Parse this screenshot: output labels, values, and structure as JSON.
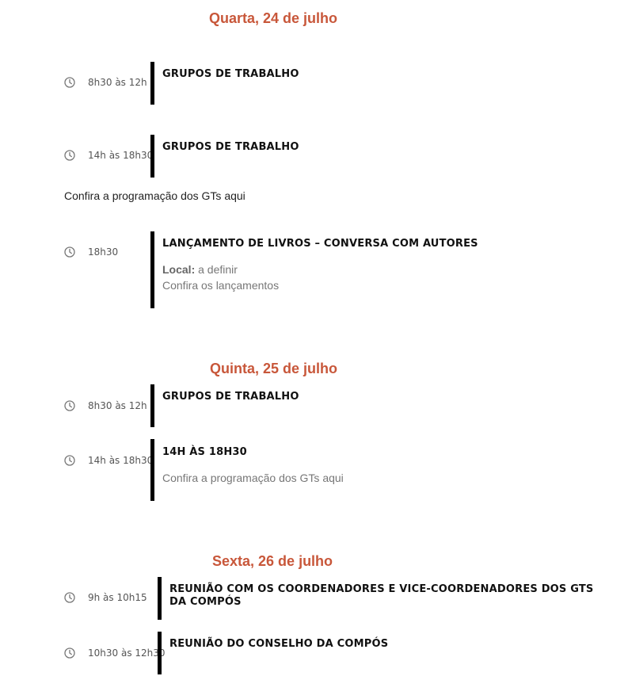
{
  "days": [
    {
      "title": "Quarta, 24 de julho",
      "events": [
        {
          "time": "8h30 às 12h",
          "title": "GRUPOS DE TRABALHO"
        },
        {
          "time": "14h às 18h30",
          "title": "GRUPOS DE TRABALHO"
        },
        {
          "time": "18h30",
          "title": "LANÇAMENTO DE LIVROS – CONVERSA COM AUTORES",
          "local_label": "Local:",
          "local_value": "a definir",
          "link": "Confira os lançamentos"
        }
      ],
      "note": "Confira a programação dos GTs aqui"
    },
    {
      "title": "Quinta, 25 de julho",
      "events": [
        {
          "time": "8h30 às 12h",
          "title": "GRUPOS DE TRABALHO"
        },
        {
          "time": "14h às 18h30",
          "title": "14H ÀS 18H30",
          "link": "Confira a programação dos GTs aqui"
        }
      ]
    },
    {
      "title": "Sexta, 26 de julho",
      "events": [
        {
          "time": "9h às 10h15",
          "title": "REUNIÃO COM OS COORDENADORES E VICE-COORDENADORES DOS GTS DA COMPÓS"
        },
        {
          "time": "10h30 às 12h30",
          "title": "REUNIÃO DO CONSELHO DA COMPÓS"
        }
      ]
    }
  ],
  "icons": {
    "clock": "clock-icon"
  },
  "colors": {
    "day_heading": "#c8573a",
    "bar": "#000000"
  }
}
